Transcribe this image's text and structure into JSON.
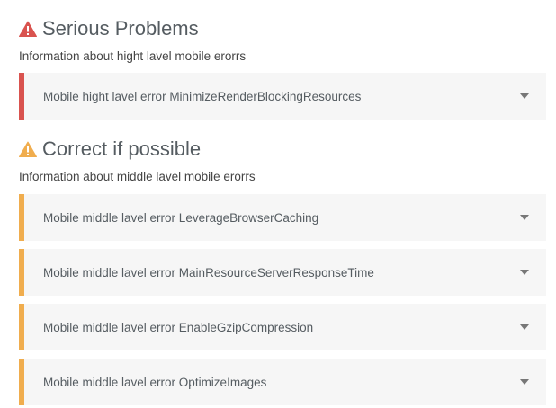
{
  "sections": [
    {
      "icon": "warning-triangle-icon",
      "icon_color": "#d9534f",
      "title": "Serious Problems",
      "description": "Information about hight lavel mobile erorrs",
      "accent": "#d9534f",
      "items": [
        {
          "label": "Mobile hight lavel error MinimizeRenderBlockingResources"
        }
      ]
    },
    {
      "icon": "warning-triangle-icon",
      "icon_color": "#f0ad4e",
      "title": "Correct if possible",
      "description": "Information about middle lavel mobile erorrs",
      "accent": "#f0ad4e",
      "items": [
        {
          "label": "Mobile middle lavel error LeverageBrowserCaching"
        },
        {
          "label": "Mobile middle lavel error MainResourceServerResponseTime"
        },
        {
          "label": "Mobile middle lavel error EnableGzipCompression"
        },
        {
          "label": "Mobile middle lavel error OptimizeImages"
        }
      ]
    }
  ]
}
